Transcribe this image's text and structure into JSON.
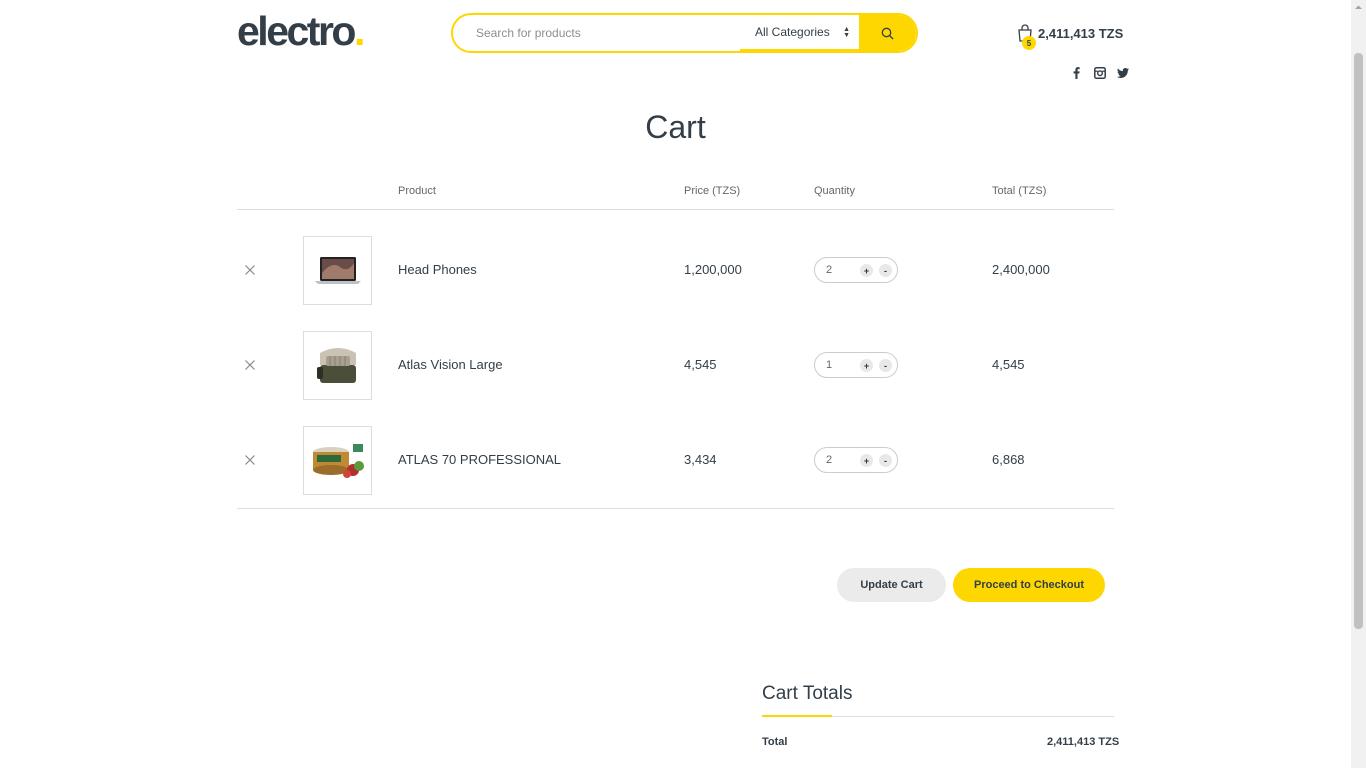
{
  "brand": {
    "name": "electro",
    "dot": ".",
    "accent_color": "#fed700",
    "text_color": "#333e48"
  },
  "search": {
    "placeholder": "Search for products",
    "category": "All Categories",
    "button_icon": "search-icon"
  },
  "mini_cart": {
    "count": "5",
    "amount": "2,411,413 TZS",
    "icon": "shopping-bag-icon"
  },
  "social": [
    "facebook-icon",
    "instagram-icon",
    "twitter-icon"
  ],
  "page": {
    "title": "Cart"
  },
  "table": {
    "headers": {
      "product": "Product",
      "price": "Price (TZS)",
      "quantity": "Quantity",
      "total": "Total (TZS)"
    },
    "rows": [
      {
        "name": "Head Phones",
        "price": "1,200,000",
        "quantity": "2",
        "total": "2,400,000",
        "image": "laptop"
      },
      {
        "name": "Atlas Vision Large",
        "price": "4,545",
        "quantity": "1",
        "total": "4,545",
        "image": "pet-carrier"
      },
      {
        "name": "ATLAS 70 PROFESSIONAL",
        "price": "3,434",
        "quantity": "2",
        "total": "6,868",
        "image": "pet-food-can"
      }
    ],
    "remove_symbol": "×",
    "plus_symbol": "+",
    "minus_symbol": "-"
  },
  "actions": {
    "update": "Update Cart",
    "checkout": "Proceed to Checkout"
  },
  "totals": {
    "title": "Cart Totals",
    "label": "Total",
    "value": "2,411,413 TZS"
  }
}
